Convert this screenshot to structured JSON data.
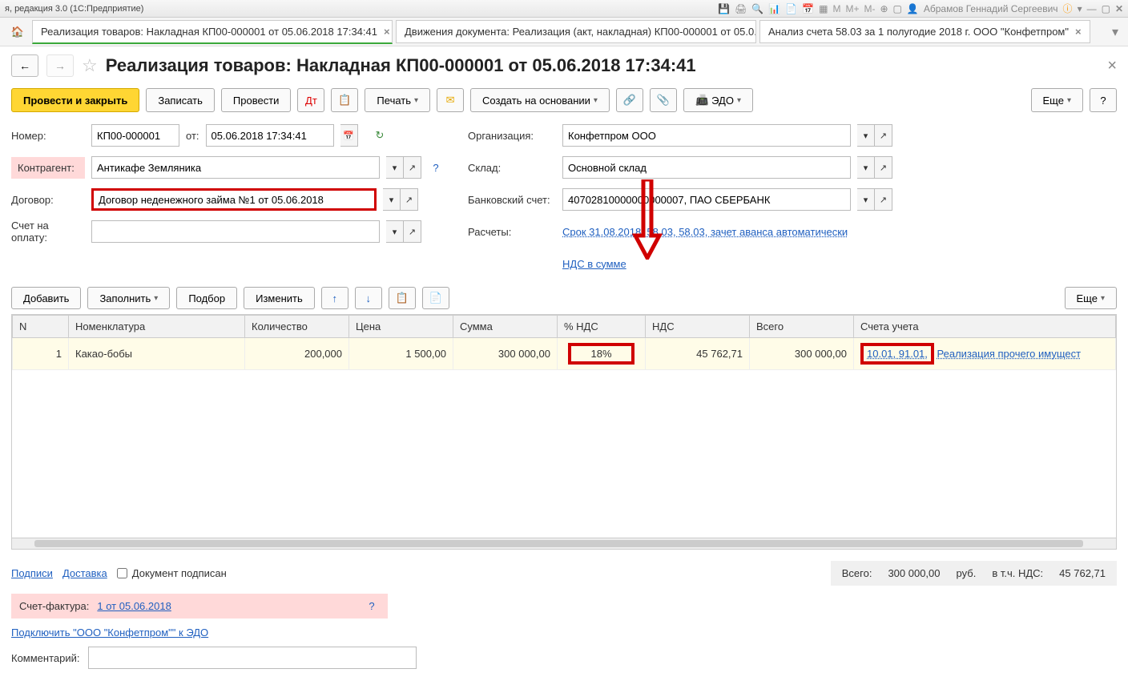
{
  "app": {
    "title": "я, редакция 3.0  (1С:Предприятие)",
    "user": "Абрамов Геннадий Сергеевич"
  },
  "tabs": [
    {
      "label": "Реализация товаров: Накладная КП00-000001 от 05.06.2018 17:34:41"
    },
    {
      "label": "Движения документа: Реализация (акт, накладная) КП00-000001 от 05.0..."
    },
    {
      "label": "Анализ счета 58.03 за 1 полугодие 2018 г. ООО \"Конфетпром\""
    }
  ],
  "page": {
    "title": "Реализация товаров: Накладная КП00-000001 от 05.06.2018 17:34:41"
  },
  "toolbar": {
    "post_close": "Провести и закрыть",
    "save": "Записать",
    "post": "Провести",
    "print": "Печать",
    "create_based": "Создать на основании",
    "edo": "ЭДО",
    "more": "Еще"
  },
  "form": {
    "number_label": "Номер:",
    "number": "КП00-000001",
    "from_label": "от:",
    "date": "05.06.2018 17:34:41",
    "contractor_label": "Контрагент:",
    "contractor": "Антикафе Земляника",
    "contract_label": "Договор:",
    "contract": "Договор неденежного займа №1 от 05.06.2018",
    "invoice_label": "Счет на оплату:",
    "invoice": "",
    "org_label": "Организация:",
    "org": "Конфетпром ООО",
    "warehouse_label": "Склад:",
    "warehouse": "Основной склад",
    "bank_label": "Банковский счет:",
    "bank": "40702810000000000007, ПАО СБЕРБАНК",
    "settle_label": "Расчеты:",
    "settle": "Срок 31.08.2018, 58.03, 58.03, зачет аванса автоматически",
    "vat_link": "НДС в сумме"
  },
  "table_toolbar": {
    "add": "Добавить",
    "fill": "Заполнить",
    "select": "Подбор",
    "change": "Изменить",
    "more": "Еще"
  },
  "columns": {
    "n": "N",
    "nomen": "Номенклатура",
    "qty": "Количество",
    "price": "Цена",
    "sum": "Сумма",
    "vat_pct": "% НДС",
    "vat": "НДС",
    "total": "Всего",
    "accounts": "Счета учета"
  },
  "rows": [
    {
      "n": "1",
      "nomen": "Какао-бобы",
      "qty": "200,000",
      "price": "1 500,00",
      "sum": "300 000,00",
      "vat_pct": "18%",
      "vat": "45 762,71",
      "total": "300 000,00",
      "accounts": "10.01, 91.01,",
      "extra": "Реализация прочего имущест"
    }
  ],
  "footer": {
    "sign": "Подписи",
    "delivery": "Доставка",
    "doc_signed": "Документ подписан",
    "total_label": "Всего:",
    "total_value": "300 000,00",
    "rub": "руб.",
    "vat_incl_label": "в т.ч. НДС:",
    "vat_incl_value": "45 762,71",
    "sf_label": "Счет-фактура:",
    "sf_value": "1 от 05.06.2018",
    "connect_edo": "Подключить \"ООО \"Конфетпром\"\" к ЭДО",
    "comment_label": "Комментарий:"
  }
}
